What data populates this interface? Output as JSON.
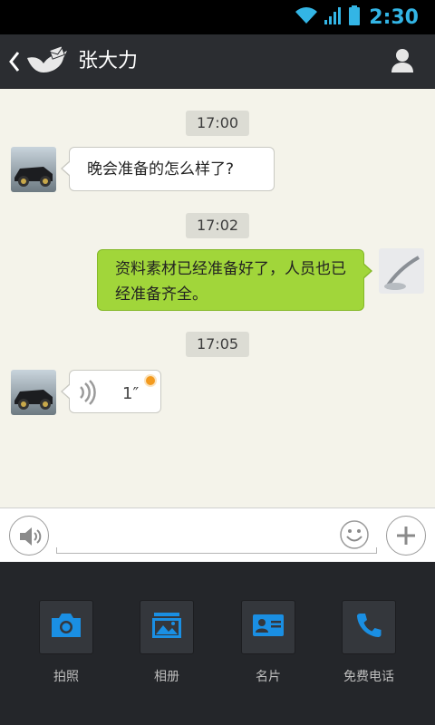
{
  "status_bar": {
    "time": "2:30",
    "accent": "#33b5e5"
  },
  "header": {
    "title": "张大力",
    "back_icon": "chevron-left-icon",
    "logo_icon": "bird-icon",
    "profile_icon": "user-icon"
  },
  "messages": [
    {
      "type": "timestamp",
      "text": "17:00"
    },
    {
      "type": "text",
      "side": "left",
      "text": "晚会准备的怎么样了?"
    },
    {
      "type": "timestamp",
      "text": "17:02"
    },
    {
      "type": "text",
      "side": "right",
      "text": "资料素材已经准备好了，人员也已经准备齐全。"
    },
    {
      "type": "timestamp",
      "text": "17:05"
    },
    {
      "type": "voice",
      "side": "left",
      "duration": "1″",
      "unread": true
    }
  ],
  "input": {
    "voice_icon": "speaker-icon",
    "emoji_icon": "smiley-icon",
    "plus_icon": "plus-icon",
    "placeholder": ""
  },
  "actions": [
    {
      "label": "拍照",
      "icon": "camera-icon"
    },
    {
      "label": "相册",
      "icon": "album-icon"
    },
    {
      "label": "名片",
      "icon": "contact-card-icon"
    },
    {
      "label": "免费电话",
      "icon": "phone-icon"
    }
  ],
  "colors": {
    "sent_bubble": "#a1d63a",
    "received_bubble": "#ffffff",
    "chat_bg": "#f4f3ea",
    "panel_bg": "#24262a",
    "action_icon": "#1a8fe3"
  }
}
